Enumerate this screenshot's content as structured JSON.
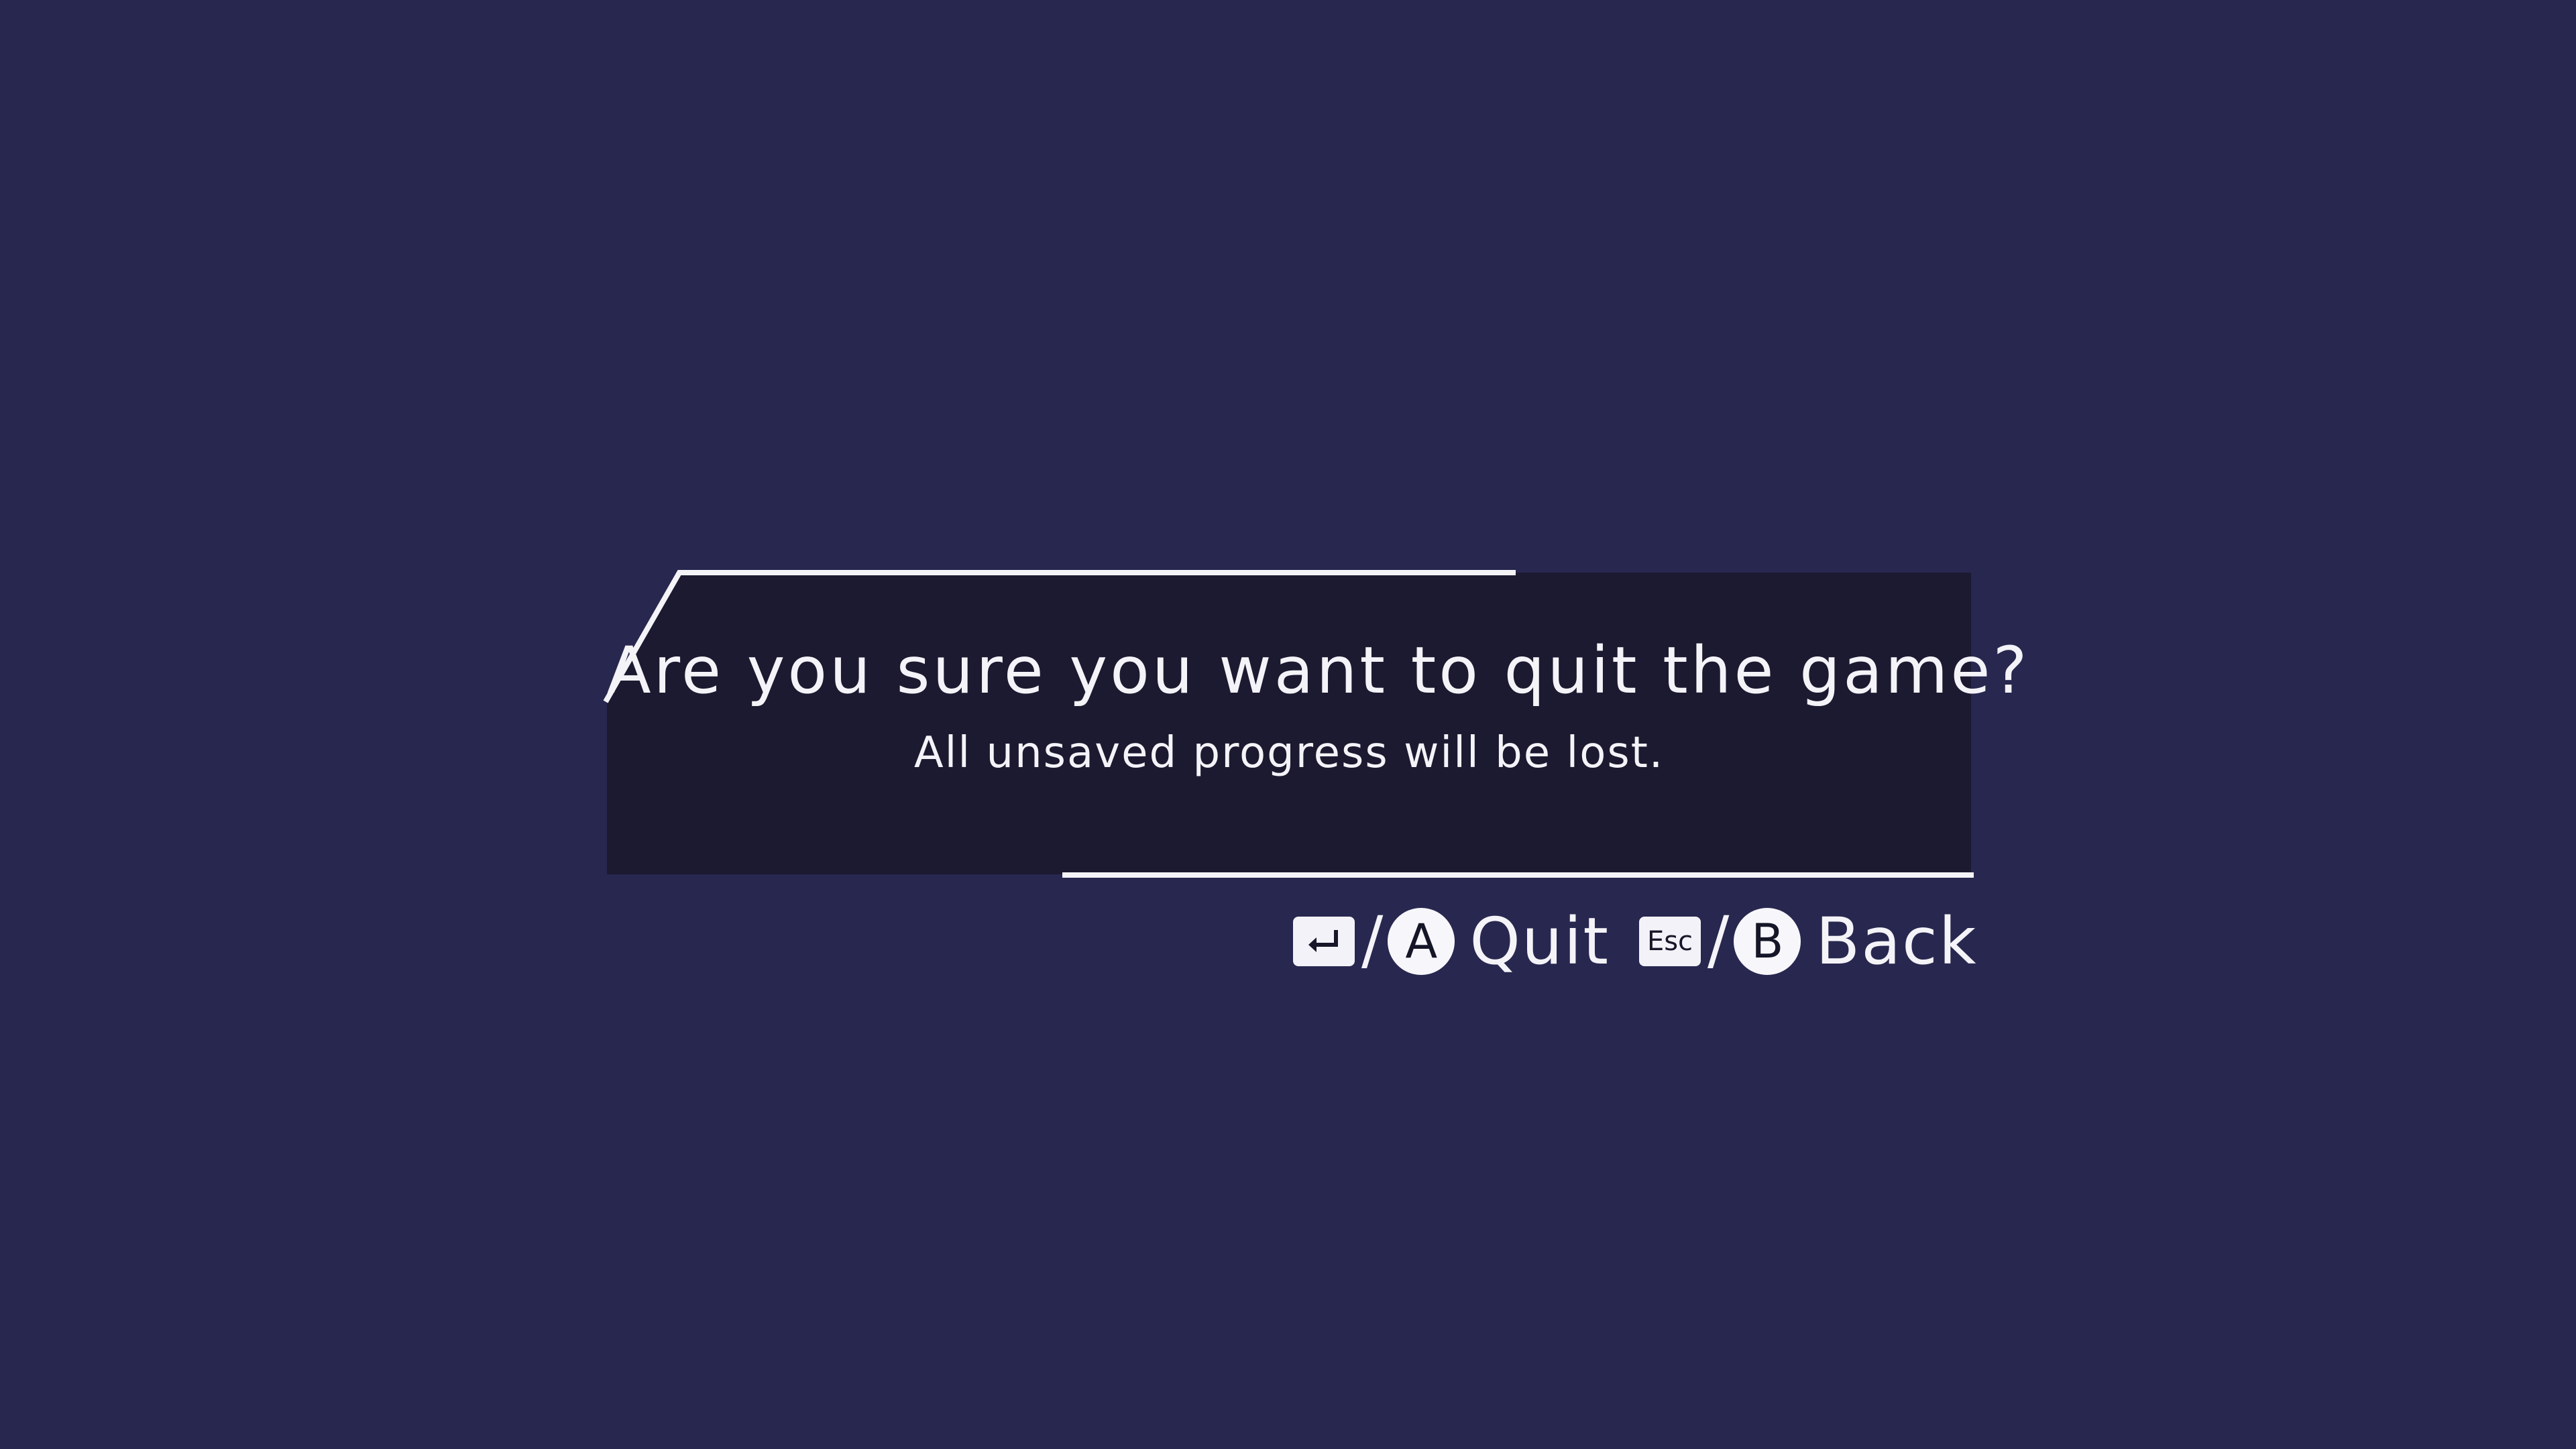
{
  "dialog": {
    "question": "Are you sure you want to quit the game?",
    "subtitle": "All unsaved progress will be lost."
  },
  "prompts": {
    "quit": {
      "keyboard_key_icon": "enter-icon",
      "separator": "/",
      "controller_button": "A",
      "label": "Quit"
    },
    "back": {
      "keyboard_key": "Esc",
      "separator": "/",
      "controller_button": "B",
      "label": "Back"
    }
  },
  "colors": {
    "background": "#28274f",
    "panel": "#1b1a30",
    "accent": "#f4f3f8"
  }
}
